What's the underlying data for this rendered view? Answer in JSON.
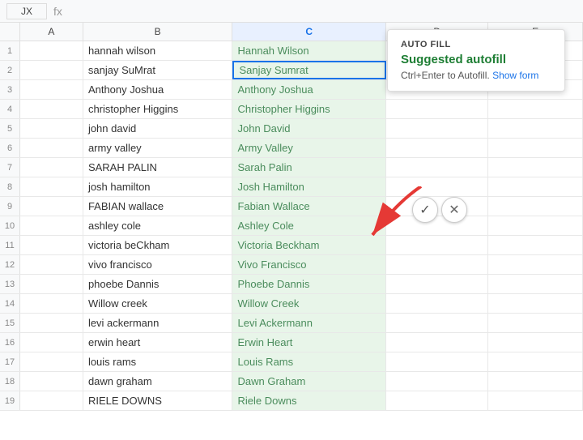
{
  "topbar": {
    "cell_ref": "JX",
    "formula_separator": "fx"
  },
  "columns": {
    "headers": [
      "",
      "A",
      "B",
      "C",
      "D",
      "E"
    ]
  },
  "rows": [
    {
      "num": "1",
      "b": "hannah wilson",
      "c": "Hannah Wilson",
      "d": "",
      "e": ""
    },
    {
      "num": "2",
      "b": "sanjay SuMrat",
      "c": "Sanjay Sumrat",
      "d": "",
      "e": ""
    },
    {
      "num": "3",
      "b": "Anthony Joshua",
      "c": "Anthony Joshua",
      "d": "",
      "e": ""
    },
    {
      "num": "4",
      "b": "christopher Higgins",
      "c": "Christopher Higgins",
      "d": "",
      "e": ""
    },
    {
      "num": "5",
      "b": "john david",
      "c": "John David",
      "d": "",
      "e": ""
    },
    {
      "num": "6",
      "b": "army valley",
      "c": "Army Valley",
      "d": "",
      "e": ""
    },
    {
      "num": "7",
      "b": "SARAH PALIN",
      "c": "Sarah Palin",
      "d": "",
      "e": ""
    },
    {
      "num": "8",
      "b": "josh hamilton",
      "c": "Josh Hamilton",
      "d": "",
      "e": ""
    },
    {
      "num": "9",
      "b": "FABIAN wallace",
      "c": "Fabian Wallace",
      "d": "",
      "e": ""
    },
    {
      "num": "10",
      "b": "ashley cole",
      "c": "Ashley Cole",
      "d": "",
      "e": ""
    },
    {
      "num": "11",
      "b": "victoria beCkham",
      "c": "Victoria Beckham",
      "d": "",
      "e": ""
    },
    {
      "num": "12",
      "b": "vivo francisco",
      "c": "Vivo Francisco",
      "d": "",
      "e": ""
    },
    {
      "num": "13",
      "b": "phoebe Dannis",
      "c": "Phoebe Dannis",
      "d": "",
      "e": ""
    },
    {
      "num": "14",
      "b": "Willow creek",
      "c": "Willow Creek",
      "d": "",
      "e": ""
    },
    {
      "num": "15",
      "b": "levi ackermann",
      "c": "Levi Ackermann",
      "d": "",
      "e": ""
    },
    {
      "num": "16",
      "b": "erwin heart",
      "c": "Erwin Heart",
      "d": "",
      "e": ""
    },
    {
      "num": "17",
      "b": "louis rams",
      "c": "Louis Rams",
      "d": "",
      "e": ""
    },
    {
      "num": "18",
      "b": "dawn graham",
      "c": "Dawn Graham",
      "d": "",
      "e": ""
    },
    {
      "num": "19",
      "b": "RIELE DOWNS",
      "c": "Riele Downs",
      "d": "",
      "e": ""
    }
  ],
  "autofill": {
    "label": "AUTO FILL",
    "title": "Suggested autofill",
    "desc": "Ctrl+Enter to Autofill.",
    "link_text": "Show form"
  },
  "buttons": {
    "accept": "✓",
    "reject": "✕"
  }
}
